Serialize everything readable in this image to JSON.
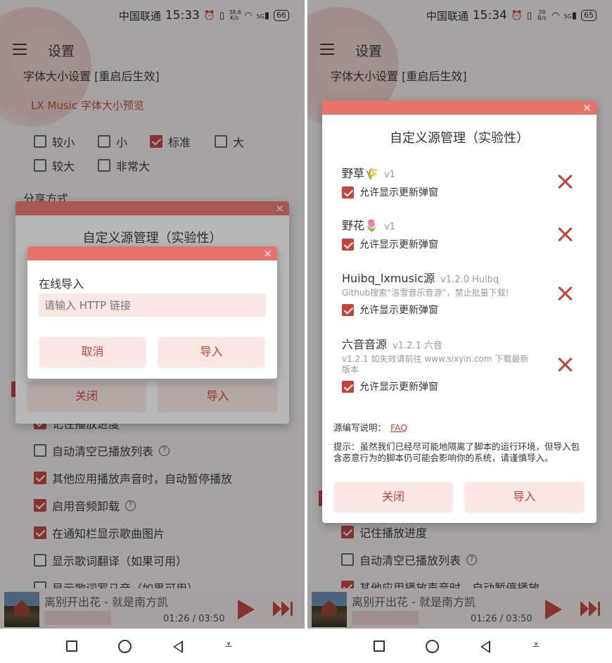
{
  "status": {
    "carrier": "中国联通",
    "left_time": "15:33",
    "right_time": "15:34",
    "left_speed": "38.6\nK/s",
    "right_speed": "39\nB/s",
    "left_battery": "66",
    "right_battery": "65",
    "signal_label": "5G"
  },
  "header": {
    "title": "设置"
  },
  "settings": {
    "font_section": "字体大小设置 [重启后生效]",
    "font_preview": "LX Music 字体大小预览",
    "font_options": [
      {
        "label": "较小",
        "checked": false
      },
      {
        "label": "小",
        "checked": false
      },
      {
        "label": "标准",
        "checked": true
      },
      {
        "label": "大",
        "checked": false
      },
      {
        "label": "较大",
        "checked": false
      },
      {
        "label": "非常大",
        "checked": false
      }
    ],
    "share_section": "分享方式",
    "left_items": [
      {
        "label": "记住播放进度",
        "checked": true,
        "help": false
      },
      {
        "label": "自动清空已播放列表",
        "checked": false,
        "help": true
      },
      {
        "label": "其他应用播放声音时，自动暂停播放",
        "checked": true,
        "help": false
      },
      {
        "label": "启用音频卸载",
        "checked": true,
        "help": true
      },
      {
        "label": "在通知栏显示歌曲图片",
        "checked": true,
        "help": false
      },
      {
        "label": "显示歌词翻译（如果可用）",
        "checked": false,
        "help": false
      },
      {
        "label": "显示歌词罗马音（如果可用）",
        "checked": false,
        "help": false
      }
    ],
    "right_items": [
      {
        "label": "记住播放进度",
        "checked": true,
        "help": false
      },
      {
        "label": "自动清空已播放列表",
        "checked": false,
        "help": true
      },
      {
        "label": "其他应用播放声音时，自动暂停播放",
        "checked": true,
        "help": false
      }
    ]
  },
  "source_dialog": {
    "title": "自定义源管理（实验性）",
    "close_label": "关闭",
    "import_label": "导入",
    "close_glyph": "×",
    "sources": [
      {
        "name": "野草🌾",
        "version": "v1",
        "desc": "",
        "allow": "允许显示更新弹窗"
      },
      {
        "name": "野花🌷",
        "version": "v1",
        "desc": "",
        "allow": "允许显示更新弹窗"
      },
      {
        "name": "Huibq_lxmusic源",
        "version": "v1.2.0  Huibq",
        "desc": "Github搜索“洛雪音乐音源”，禁止批量下载!",
        "allow": "允许显示更新弹窗"
      },
      {
        "name": "六音音源",
        "version": "v1.2.1  六音",
        "desc": "v1.2.1 如失效请前往 www.sixyin.com 下载最新版本",
        "allow": "允许显示更新弹窗"
      }
    ],
    "guide_label": "源编写说明：",
    "guide_link": "FAQ",
    "tip": "提示：虽然我们已经尽可能地隔离了脚本的运行环境，但导入包含恶意行为的脚本仍可能会影响你的系统，请谨慎导入。"
  },
  "online_import_dialog": {
    "title": "在线导入",
    "placeholder": "请输入 HTTP 链接",
    "cancel_label": "取消",
    "import_label": "导入"
  },
  "player": {
    "song": "离别开出花 - 就是南方凯",
    "time": "01:26 / 03:50"
  },
  "nav": {
    "notification_glyph": "⩡"
  }
}
